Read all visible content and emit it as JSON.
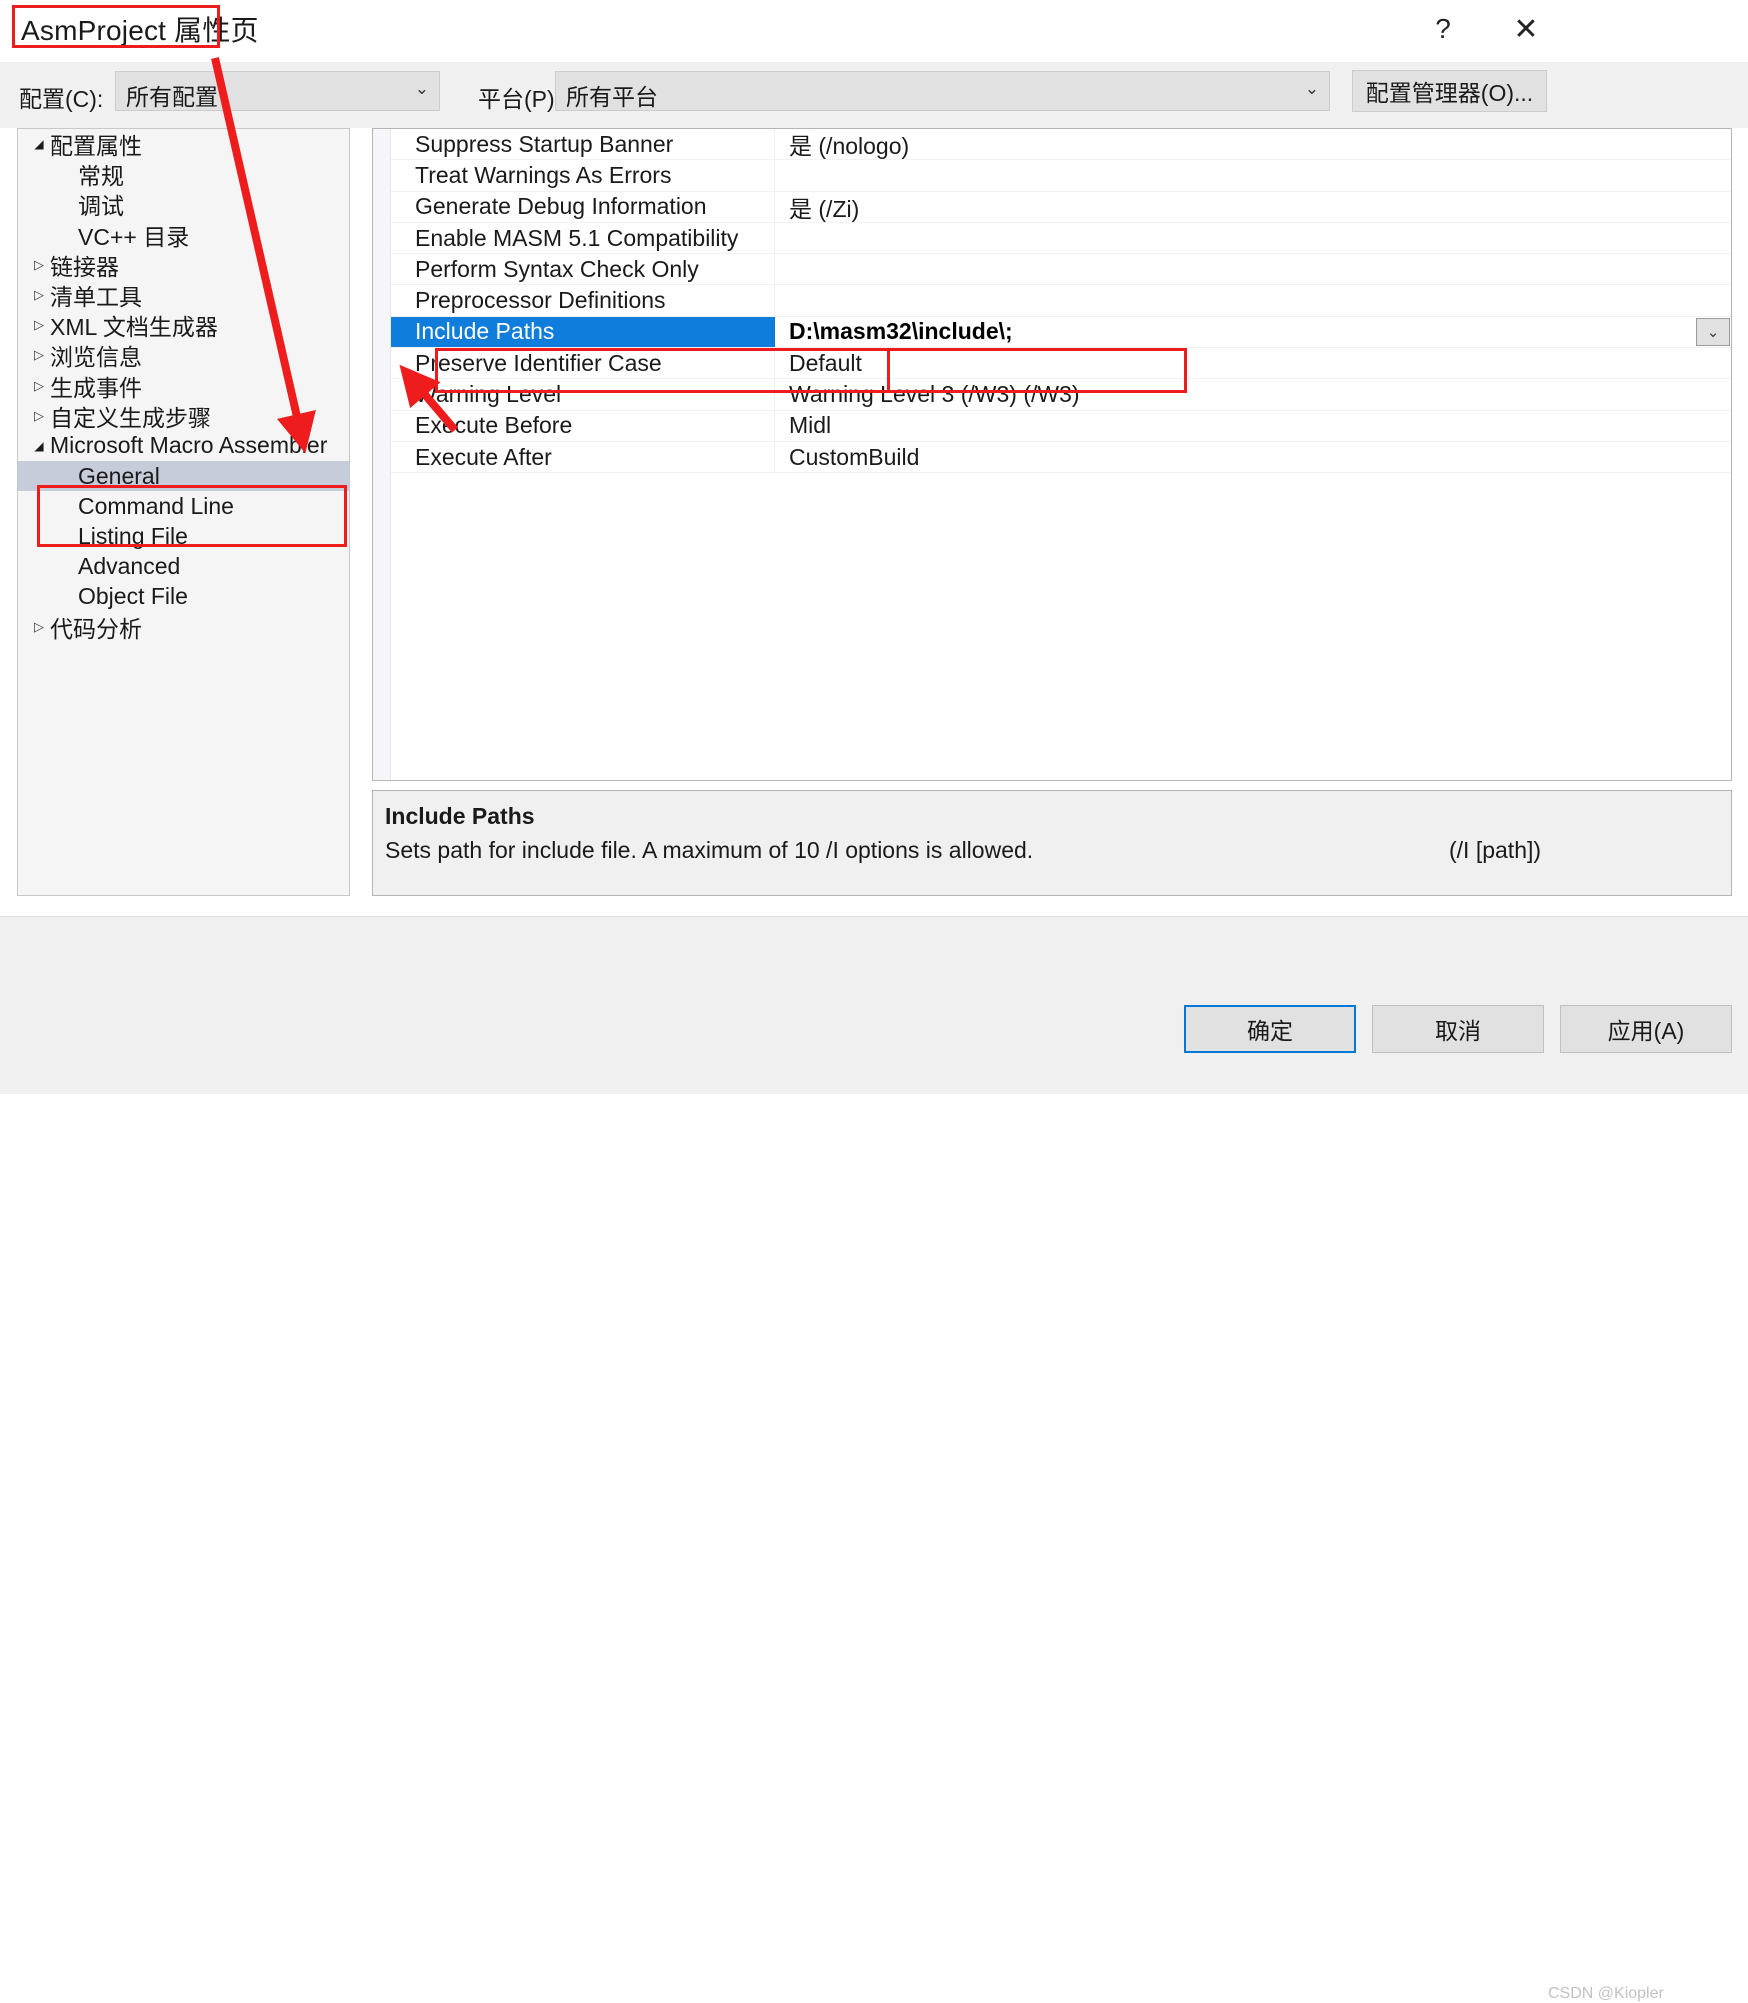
{
  "window": {
    "title": "AsmProject 属性页",
    "help_icon": "?",
    "close_icon": "✕"
  },
  "configbar": {
    "config_label": "配置(C):",
    "config_value": "所有配置",
    "platform_label": "平台(P):",
    "platform_value": "所有平台",
    "config_manager_label": "配置管理器(O)...",
    "arrow_glyph": "⌄"
  },
  "tree": {
    "items": [
      {
        "label": "配置属性",
        "indent": 0,
        "arrow": "expanded",
        "selected": false
      },
      {
        "label": "常规",
        "indent": 1,
        "arrow": "none",
        "selected": false
      },
      {
        "label": "调试",
        "indent": 1,
        "arrow": "none",
        "selected": false
      },
      {
        "label": "VC++ 目录",
        "indent": 1,
        "arrow": "none",
        "selected": false
      },
      {
        "label": "链接器",
        "indent": 0,
        "arrow": "collapsed",
        "selected": false
      },
      {
        "label": "清单工具",
        "indent": 0,
        "arrow": "collapsed",
        "selected": false
      },
      {
        "label": "XML 文档生成器",
        "indent": 0,
        "arrow": "collapsed",
        "selected": false
      },
      {
        "label": "浏览信息",
        "indent": 0,
        "arrow": "collapsed",
        "selected": false
      },
      {
        "label": "生成事件",
        "indent": 0,
        "arrow": "collapsed",
        "selected": false
      },
      {
        "label": "自定义生成步骤",
        "indent": 0,
        "arrow": "collapsed",
        "selected": false
      },
      {
        "label": "Microsoft Macro Assembler",
        "indent": 0,
        "arrow": "expanded",
        "selected": false
      },
      {
        "label": "General",
        "indent": 1,
        "arrow": "none",
        "selected": true
      },
      {
        "label": "Command Line",
        "indent": 1,
        "arrow": "none",
        "selected": false
      },
      {
        "label": "Listing File",
        "indent": 1,
        "arrow": "none",
        "selected": false
      },
      {
        "label": "Advanced",
        "indent": 1,
        "arrow": "none",
        "selected": false
      },
      {
        "label": "Object File",
        "indent": 1,
        "arrow": "none",
        "selected": false
      },
      {
        "label": "代码分析",
        "indent": 0,
        "arrow": "collapsed",
        "selected": false
      }
    ],
    "arrow_expanded_glyph": "◢",
    "arrow_collapsed_glyph": "▷"
  },
  "grid": {
    "rows": [
      {
        "name": "Suppress Startup Banner",
        "value": "是 (/nologo)",
        "selected": false
      },
      {
        "name": "Treat Warnings As Errors",
        "value": "",
        "selected": false
      },
      {
        "name": "Generate Debug Information",
        "value": "是 (/Zi)",
        "selected": false
      },
      {
        "name": "Enable MASM 5.1 Compatibility",
        "value": "",
        "selected": false
      },
      {
        "name": "Perform Syntax Check Only",
        "value": "",
        "selected": false
      },
      {
        "name": "Preprocessor Definitions",
        "value": "",
        "selected": false
      },
      {
        "name": "Include Paths",
        "value": "D:\\masm32\\include\\;",
        "selected": true
      },
      {
        "name": "Preserve Identifier Case",
        "value": "Default",
        "selected": false
      },
      {
        "name": "Warning Level",
        "value": "Warning Level 3 (/W3) (/W3)",
        "selected": false
      },
      {
        "name": "Execute Before",
        "value": "Midl",
        "selected": false
      },
      {
        "name": "Execute After",
        "value": "CustomBuild",
        "selected": false
      }
    ],
    "dropdown_arrow_glyph": "⌄"
  },
  "description": {
    "title": "Include Paths",
    "body": "Sets path for include file. A maximum of 10 /I options is allowed.",
    "syntax": "(/I [path])"
  },
  "footer": {
    "ok_label": "确定",
    "cancel_label": "取消",
    "apply_label": "应用(A)"
  },
  "watermark": "CSDN @Kiopler",
  "colors": {
    "selection_blue": "#0f7ddb",
    "tree_selection": "#c6ccd9",
    "annotation_red": "#ee1c1c",
    "default_button_border": "#0078d7"
  }
}
